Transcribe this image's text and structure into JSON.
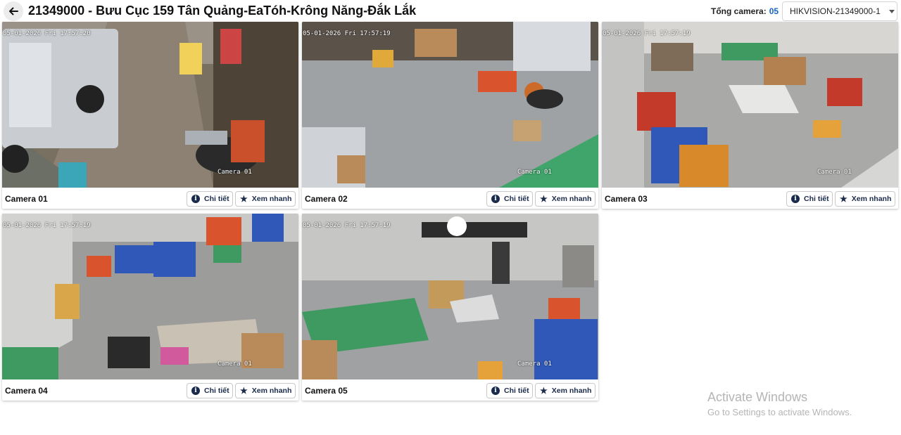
{
  "header": {
    "title": "21349000 - Bưu Cục 159 Tân Quảng-EaTóh-Krông Năng-Đắk Lắk",
    "total_label": "Tổng camera:",
    "total_count": "05",
    "selected_device": "HIKVISION-21349000-1"
  },
  "cameras": [
    {
      "label": "Camera 01",
      "osd_time": "05-01-2026 Fri 17:57:20",
      "osd_name": "Camera 01",
      "detail_label": "Chi tiết",
      "quick_label": "Xem nhanh"
    },
    {
      "label": "Camera 02",
      "osd_time": "05-01-2026 Fri 17:57:19",
      "osd_name": "Camera 01",
      "detail_label": "Chi tiết",
      "quick_label": "Xem nhanh"
    },
    {
      "label": "Camera 03",
      "osd_time": "05-01-2026 Fri 17:57:19",
      "osd_name": "Camera 01",
      "detail_label": "Chi tiết",
      "quick_label": "Xem nhanh"
    },
    {
      "label": "Camera 04",
      "osd_time": "05-01-2026 Fri 17:57:19",
      "osd_name": "Camera 01",
      "detail_label": "Chi tiết",
      "quick_label": "Xem nhanh"
    },
    {
      "label": "Camera 05",
      "osd_time": "05-01-2026 Fri 17:57:19",
      "osd_name": "Camera 01",
      "detail_label": "Chi tiết",
      "quick_label": "Xem nhanh"
    }
  ],
  "watermark": {
    "title": "Activate Windows",
    "subtitle": "Go to Settings to activate Windows."
  },
  "icons": {
    "back": "arrow-left-icon",
    "detail": "info-icon",
    "quick": "star-icon",
    "dropdown": "chevron-down-icon"
  }
}
